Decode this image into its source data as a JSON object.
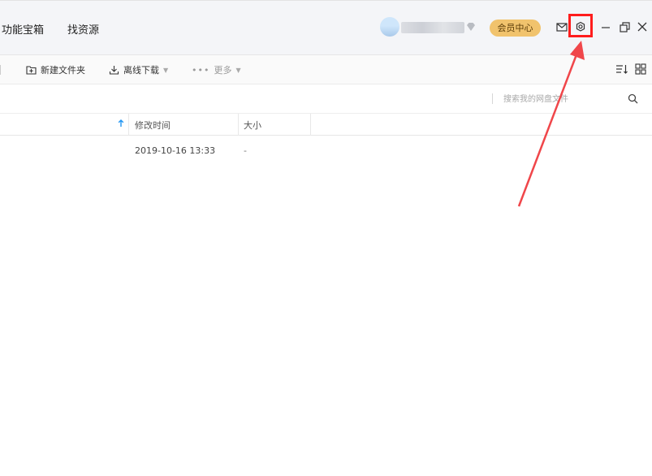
{
  "header": {
    "nav": [
      "功能宝箱",
      "找资源"
    ],
    "vip_label": "会员中心",
    "icons": [
      "mail-icon",
      "settings-icon",
      "minimize-icon",
      "restore-icon",
      "close-icon"
    ]
  },
  "toolbar": {
    "new_folder": "新建文件夹",
    "offline_download": "离线下载",
    "more": "更多"
  },
  "search": {
    "placeholder": "搜索我的网盘文件"
  },
  "table": {
    "columns": [
      "修改时间",
      "大小"
    ],
    "rows": [
      {
        "modified": "2019-10-16 13:33",
        "size": "-"
      }
    ]
  },
  "colors": {
    "vip": "#f1c36d",
    "highlight": "#ff1d1d",
    "sort_arrow": "#2196f3"
  }
}
